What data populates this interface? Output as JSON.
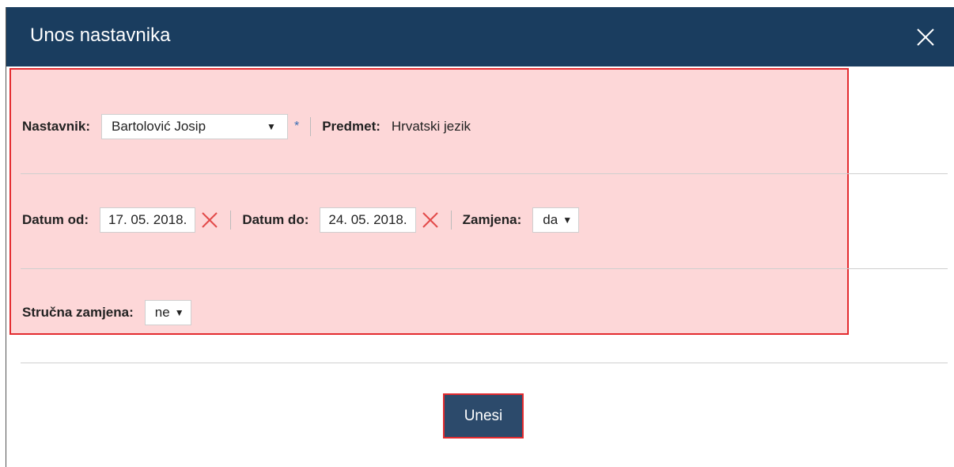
{
  "dialog": {
    "title": "Unos nastavnika",
    "close_icon": "close-icon"
  },
  "colors": {
    "titlebar": "#1a3d5f",
    "highlight_fill": "#fdd7d8",
    "highlight_border": "#e32b2f",
    "button_bg": "#2c4a6b",
    "required_marker": "#3b6fb3"
  },
  "form": {
    "nastavnik": {
      "label": "Nastavnik:",
      "value": "Bartolović Josip",
      "required_marker": "*"
    },
    "predmet": {
      "label": "Predmet:",
      "value": "Hrvatski jezik"
    },
    "datum_od": {
      "label": "Datum od:",
      "value": "17. 05. 2018."
    },
    "datum_do": {
      "label": "Datum do:",
      "value": "24. 05. 2018."
    },
    "zamjena": {
      "label": "Zamjena:",
      "value": "da"
    },
    "strucna_zamjena": {
      "label": "Stručna zamjena:",
      "value": "ne"
    }
  },
  "actions": {
    "submit_label": "Unesi"
  }
}
